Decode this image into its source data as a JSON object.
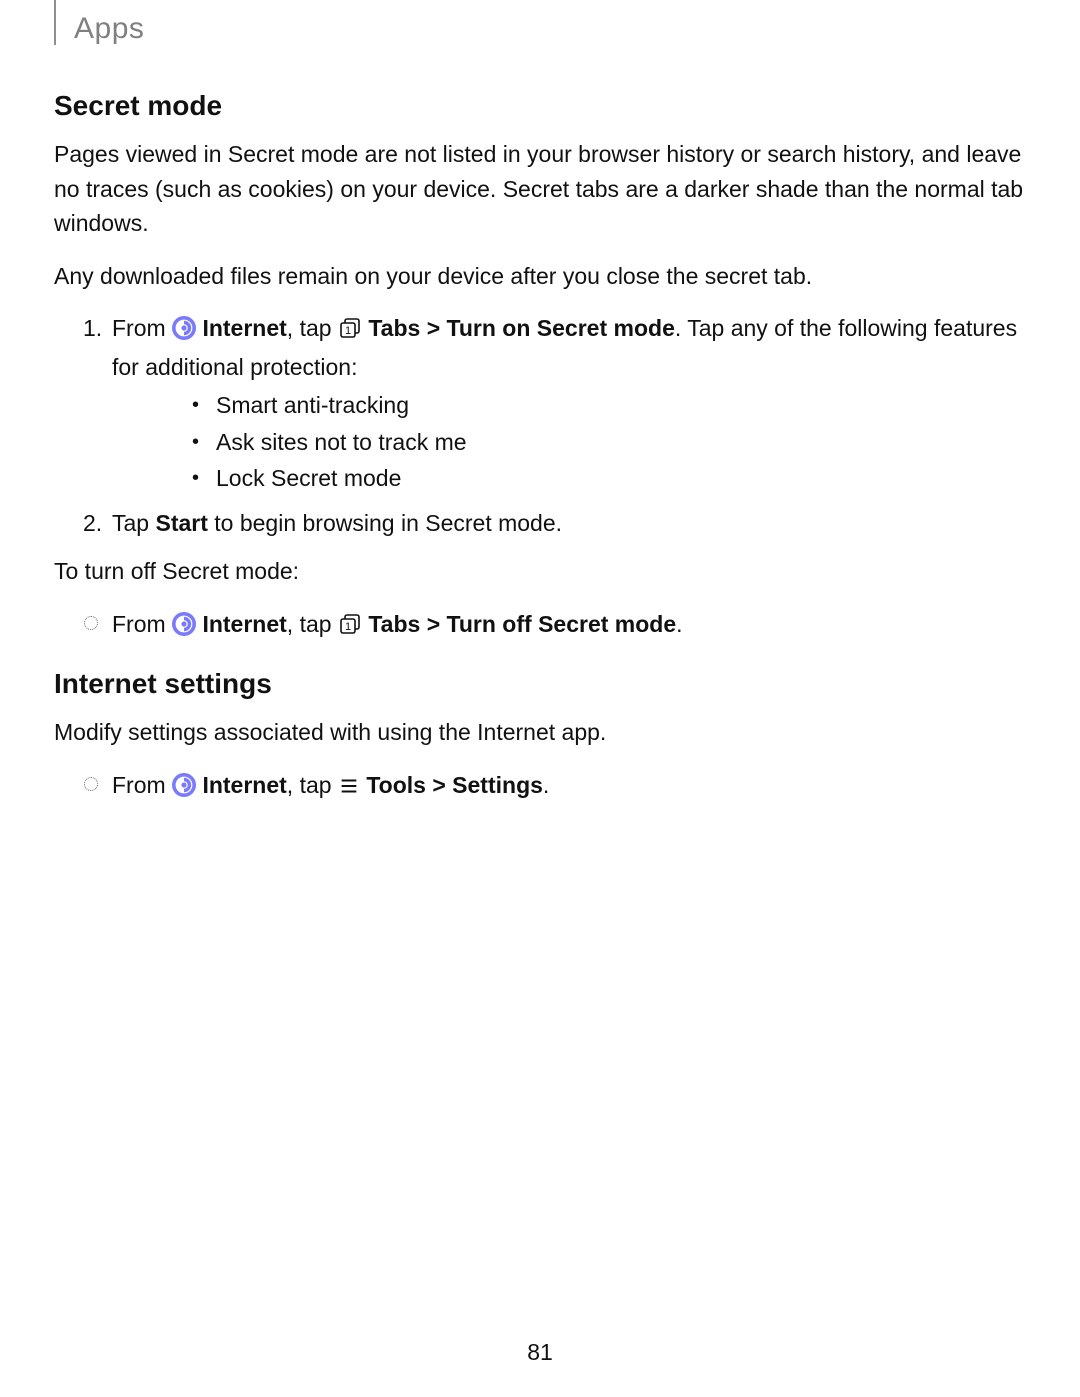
{
  "header": {
    "title": "Apps"
  },
  "sections": {
    "secret_mode": {
      "heading": "Secret mode",
      "p1": "Pages viewed in Secret mode are not listed in your browser history or search history, and leave no traces (such as cookies) on your device. Secret tabs are a darker shade than the normal tab windows.",
      "p2": "Any downloaded files remain on your device after you close the secret tab.",
      "step1": {
        "num": "1.",
        "t_from": "From ",
        "t_internet": "Internet",
        "t_comma_tap": ", tap ",
        "t_tabs_path": "Tabs > Turn on Secret mode",
        "t_tap_any": ". Tap any of the following features for additional protection:"
      },
      "features": [
        "Smart anti-tracking",
        "Ask sites not to track me",
        "Lock Secret mode"
      ],
      "step2": {
        "num": "2.",
        "t1": "Tap ",
        "t2": "Start",
        "t3": " to begin browsing in Secret mode."
      },
      "p3": "To turn off Secret mode:",
      "off_step": {
        "t_from": "From ",
        "t_internet": "Internet",
        "t_comma_tap": ", tap ",
        "t_tabs_path": "Tabs > Turn off Secret mode",
        "t_period": "."
      }
    },
    "internet_settings": {
      "heading": "Internet settings",
      "p1": "Modify settings associated with using the Internet app.",
      "step": {
        "t_from": "From ",
        "t_internet": "Internet",
        "t_comma_tap": ", tap ",
        "t_tools": "Tools > Settings",
        "t_period": "."
      }
    }
  },
  "page_number": "81"
}
